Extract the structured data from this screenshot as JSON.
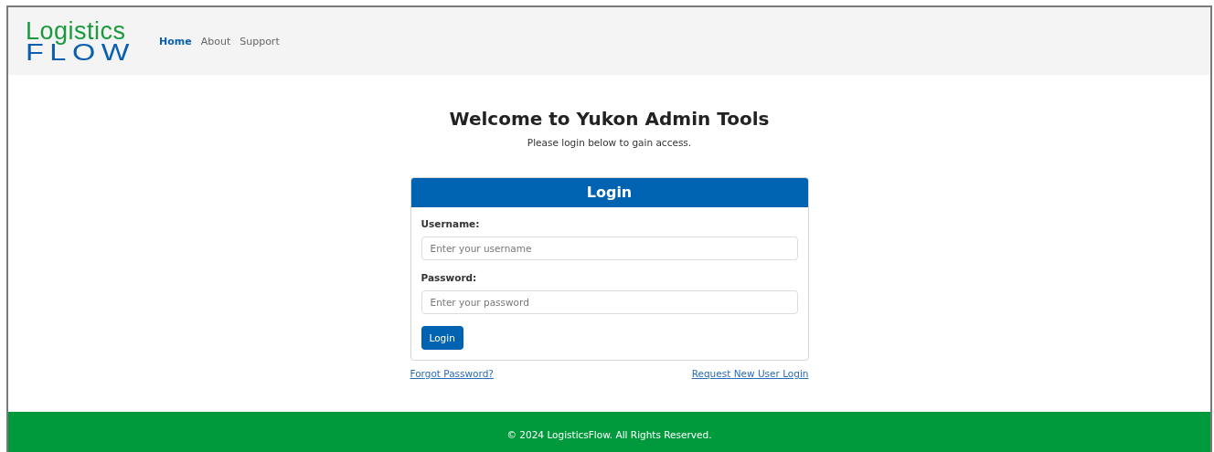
{
  "logo": {
    "line_1": "Logistics",
    "line_2": "FLOW"
  },
  "nav": [
    {
      "label": "Home",
      "selected": true
    },
    {
      "label": "About",
      "selected": false
    },
    {
      "label": "Support",
      "selected": false
    }
  ],
  "heading": "Welcome to Yukon Admin Tools",
  "subheading": "Please login below to gain access.",
  "login_card": {
    "title": "Login",
    "fields": [
      {
        "label": "Username:",
        "placeholder": "Enter your username"
      },
      {
        "label": "Password:",
        "placeholder": "Enter your password"
      }
    ],
    "button": "Login"
  },
  "links": [
    "Forgot Password?",
    "Request New User Login"
  ],
  "footer": "© 2024 LogisticsFlow. All Rights Reserved."
}
